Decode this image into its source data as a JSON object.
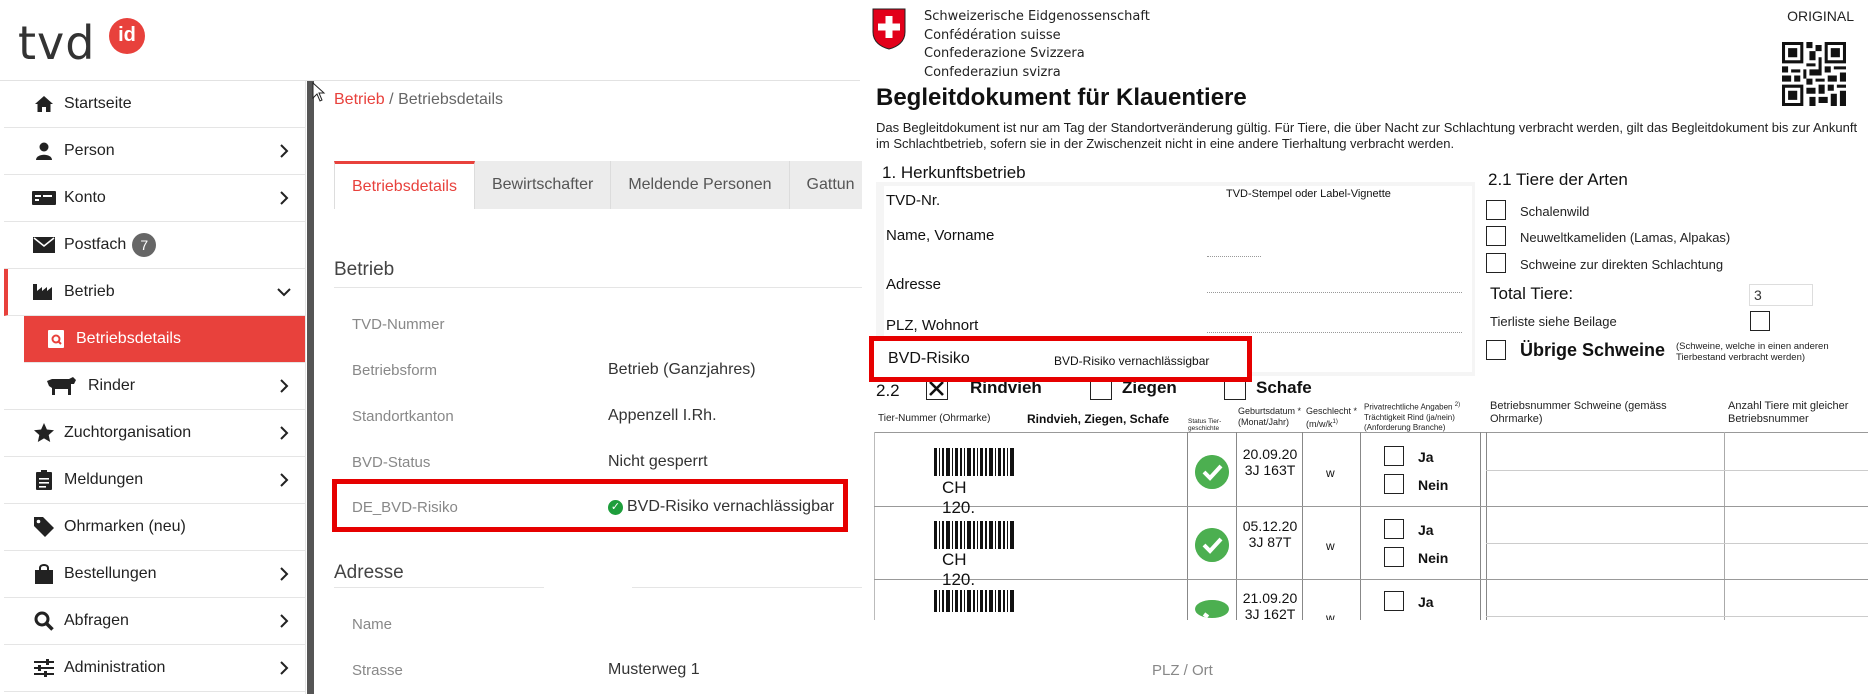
{
  "app": {
    "logo_text": "tvd",
    "logo_badge": "id"
  },
  "sidebar": {
    "items": [
      {
        "label": "Startseite",
        "icon": "home-icon"
      },
      {
        "label": "Person",
        "icon": "person-icon"
      },
      {
        "label": "Konto",
        "icon": "wallet-icon"
      },
      {
        "label": "Postfach",
        "icon": "envelope-icon",
        "badge": "7"
      },
      {
        "label": "Betrieb",
        "icon": "factory-icon"
      },
      {
        "label": "Betriebsdetails",
        "icon": "document-search-icon"
      },
      {
        "label": "Rinder",
        "icon": "cow-icon"
      },
      {
        "label": "Zuchtorganisation",
        "icon": "star-icon"
      },
      {
        "label": "Meldungen",
        "icon": "clipboard-icon"
      },
      {
        "label": "Ohrmarken (neu)",
        "icon": "tag-icon"
      },
      {
        "label": "Bestellungen",
        "icon": "shopping-bag-icon"
      },
      {
        "label": "Abfragen",
        "icon": "search-icon"
      },
      {
        "label": "Administration",
        "icon": "sliders-icon"
      }
    ]
  },
  "breadcrumb": {
    "link": "Betrieb",
    "separator": "/",
    "current": "Betriebsdetails"
  },
  "tabs": [
    "Betriebsdetails",
    "Bewirtschafter",
    "Meldende Personen",
    "Gattun"
  ],
  "betrieb": {
    "title": "Betrieb",
    "fields": [
      {
        "label": "TVD-Nummer",
        "value": ""
      },
      {
        "label": "Betriebsform",
        "value": "Betrieb (Ganzjahres)"
      },
      {
        "label": "Standortkanton",
        "value": "Appenzell I.Rh."
      },
      {
        "label": "BVD-Status",
        "value": "Nicht gesperrt"
      },
      {
        "label": "DE_BVD-Risiko",
        "value": "BVD-Risiko vernachlässigbar"
      }
    ]
  },
  "adresse": {
    "title": "Adresse",
    "fields": [
      {
        "label": "Name",
        "value": ""
      },
      {
        "label": "Strasse",
        "value": "Musterweg 1"
      }
    ],
    "plz_label": "PLZ / Ort"
  },
  "document": {
    "federal_names": [
      "Schweizerische Eidgenossenschaft",
      "Confédération suisse",
      "Confederazione Svizzera",
      "Confederaziun svizra"
    ],
    "original": "ORIGINAL",
    "title": "Begleitdokument für Klauentiere",
    "intro": "Das Begleitdokument ist nur am Tag der Standortveränderung gültig. Für Tiere, die über Nacht zur Schlachtung verbracht werden, gilt das Begleitdokument bis zur Ankunft im Schlachtbetrieb, sofern sie in der Zwischenzeit nicht in eine andere Tierhaltung verbracht werden.",
    "sec1": {
      "title": "1. Herkunftsbetrieb",
      "tvd_nr": "TVD-Nr.",
      "stamp": "TVD-Stempel oder Label-Vignette",
      "name": "Name, Vorname",
      "adresse": "Adresse",
      "plz": "PLZ, Wohnort",
      "bvd_label": "BVD-Risiko",
      "bvd_value": "BVD-Risiko vernachlässigbar"
    },
    "sec21": {
      "title": "2.1 Tiere der Arten",
      "options": [
        "Schalenwild",
        "Neuweltkameliden (Lamas, Alpakas)",
        "Schweine zur direkten Schlachtung"
      ],
      "total_label": "Total Tiere:",
      "total_value": "3",
      "tierliste": "Tierliste siehe Beilage",
      "uebrige": "Übrige Schweine",
      "uebrige_note": "(Schweine, welche in einen anderen Tierbestand verbracht werden)"
    },
    "sec22": {
      "number": "2.2",
      "rindvieh": "Rindvieh",
      "ziegen": "Ziegen",
      "schafe": "Schafe",
      "headers": {
        "tier_nr": "Tier-Nummer (Ohrmarke)",
        "species": "Rindvieh, Ziegen, Schafe",
        "status": "Status Tier-geschichte",
        "geburt": "Geburtsdatum * (Monat/Jahr)",
        "geschlecht": "Geschlecht * (m/w/k",
        "geschlecht_sup": "1)",
        "privat": "Privatrechtliche Angaben",
        "privat_sup": "2)",
        "privat2": "Trächtigkeit Rind (ja/nein) (Anforderung Branche)",
        "schweine_nr": "Betriebsnummer Schweine (gemäss Ohrmarke)",
        "anzahl": "Anzahl Tiere mit gleicher Betriebsnummer"
      },
      "rows": [
        {
          "tier": "CH 120.",
          "date": "20.09.20",
          "age": "3J 163T",
          "sex": "w"
        },
        {
          "tier": "CH 120.",
          "date": "05.12.20",
          "age": "3J 87T",
          "sex": "w"
        },
        {
          "tier": "",
          "date": "21.09.20",
          "age": "3J 162T",
          "sex": "w"
        }
      ],
      "ja": "Ja",
      "nein": "Nein"
    }
  }
}
